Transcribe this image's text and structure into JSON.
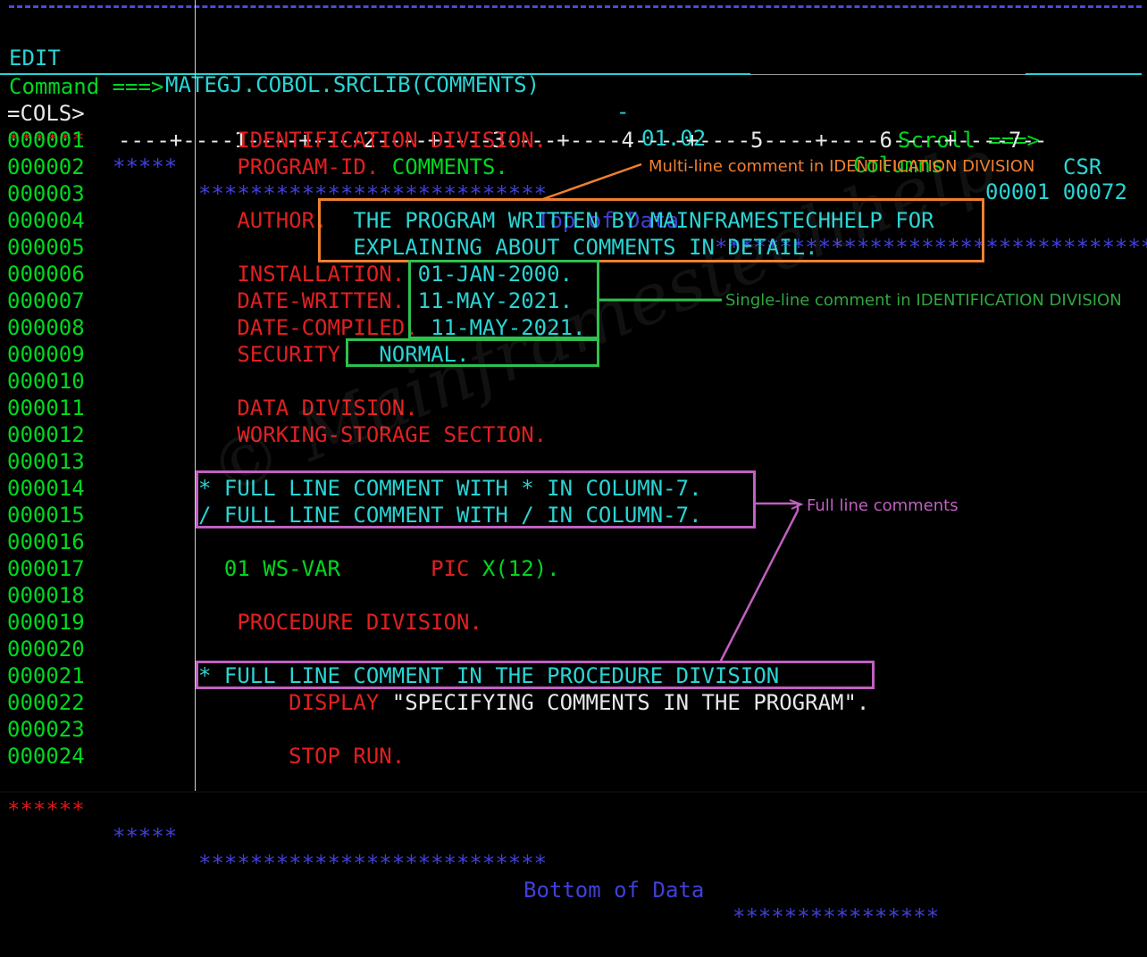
{
  "header": {
    "mode": "EDIT",
    "dataset": "MATEGJ.COBOL.SRCLIB(COMMENTS)",
    "dash": "-",
    "version": "01.02",
    "columns_label": "Columns",
    "columns_value": "00001 00072",
    "command_label": "Command ===>",
    "command_value": "",
    "scroll_label": "Scroll ===>",
    "scroll_value": "CSR"
  },
  "cols_ruler": {
    "prefix": "=COLS>",
    "ruler": "----+----1----+----2----+----3----+----4----+----5----+----6----+----7--"
  },
  "top_of_data": {
    "gutter_stars": "******",
    "stars_left": "*****",
    "stars_mid": "***************************",
    "text": "Top of Data",
    "stars_right": "*************************************"
  },
  "bottom_of_data": {
    "gutter_stars": "******",
    "stars_left": "*****",
    "stars_mid": "***************************",
    "text": "Bottom of Data",
    "stars_right": "****************"
  },
  "lines": [
    {
      "num": "000001",
      "segments": [
        {
          "t": "   IDENTIFICATION DIVISION.",
          "c": "red"
        }
      ]
    },
    {
      "num": "000002",
      "segments": [
        {
          "t": "   PROGRAM-ID. ",
          "c": "red"
        },
        {
          "t": "COMMENTS.",
          "c": "green"
        }
      ]
    },
    {
      "num": "000003",
      "segments": [
        {
          "t": "",
          "c": "red"
        }
      ]
    },
    {
      "num": "000004",
      "segments": [
        {
          "t": "   AUTHOR.  ",
          "c": "red"
        },
        {
          "t": "THE PROGRAM WRITTEN BY MAINFRAMESTECHHELP FOR",
          "c": "cyan"
        }
      ]
    },
    {
      "num": "000005",
      "segments": [
        {
          "t": "            ",
          "c": "red"
        },
        {
          "t": "EXPLAINING ABOUT COMMENTS IN DETAIL.",
          "c": "cyan"
        }
      ]
    },
    {
      "num": "000006",
      "segments": [
        {
          "t": "   INSTALLATION. ",
          "c": "red"
        },
        {
          "t": "01-JAN-2000.",
          "c": "cyan"
        }
      ]
    },
    {
      "num": "000007",
      "segments": [
        {
          "t": "   DATE-WRITTEN. ",
          "c": "red"
        },
        {
          "t": "11-MAY-2021.",
          "c": "cyan"
        }
      ]
    },
    {
      "num": "000008",
      "segments": [
        {
          "t": "   DATE-COMPILED.",
          "c": "red"
        },
        {
          "t": " 11-MAY-2021.",
          "c": "cyan"
        }
      ]
    },
    {
      "num": "000009",
      "segments": [
        {
          "t": "   SECURITY.  ",
          "c": "red"
        },
        {
          "t": "NORMAL.",
          "c": "cyan"
        }
      ]
    },
    {
      "num": "000010",
      "segments": [
        {
          "t": "",
          "c": "red"
        }
      ]
    },
    {
      "num": "000011",
      "segments": [
        {
          "t": "   DATA DIVISION.",
          "c": "red"
        }
      ]
    },
    {
      "num": "000012",
      "segments": [
        {
          "t": "   WORKING-STORAGE SECTION.",
          "c": "red"
        }
      ]
    },
    {
      "num": "000013",
      "segments": [
        {
          "t": "",
          "c": "red"
        }
      ]
    },
    {
      "num": "000014",
      "segments": [
        {
          "t": "* FULL LINE COMMENT WITH * IN COLUMN-7.",
          "c": "cyan"
        }
      ]
    },
    {
      "num": "000015",
      "segments": [
        {
          "t": "/ FULL LINE COMMENT WITH / IN COLUMN-7.",
          "c": "cyan"
        }
      ]
    },
    {
      "num": "000016",
      "segments": [
        {
          "t": "",
          "c": "red"
        }
      ]
    },
    {
      "num": "000017",
      "segments": [
        {
          "t": "  01 WS-VAR       ",
          "c": "green"
        },
        {
          "t": "PIC ",
          "c": "red"
        },
        {
          "t": "X(12).",
          "c": "green"
        }
      ]
    },
    {
      "num": "000018",
      "segments": [
        {
          "t": "",
          "c": "red"
        }
      ]
    },
    {
      "num": "000019",
      "segments": [
        {
          "t": "   PROCEDURE DIVISION.",
          "c": "red"
        }
      ]
    },
    {
      "num": "000020",
      "segments": [
        {
          "t": "",
          "c": "red"
        }
      ]
    },
    {
      "num": "000021",
      "segments": [
        {
          "t": "* FULL LINE COMMENT IN THE PROCEDURE DIVISION",
          "c": "cyan"
        }
      ]
    },
    {
      "num": "000022",
      "segments": [
        {
          "t": "       DISPLAY ",
          "c": "red"
        },
        {
          "t": "\"SPECIFYING COMMENTS IN THE PROGRAM\".",
          "c": "white"
        }
      ]
    },
    {
      "num": "000023",
      "segments": [
        {
          "t": "",
          "c": "red"
        }
      ]
    },
    {
      "num": "000024",
      "segments": [
        {
          "t": "       STOP RUN.",
          "c": "red"
        }
      ]
    }
  ],
  "annotations": [
    {
      "id": "multiline",
      "text": "Multi-line comment in IDENTIFICATION DIVISION",
      "color": "#f08030"
    },
    {
      "id": "singleline",
      "text": "Single-line comment in IDENTIFICATION DIVISION",
      "color": "#2fa840"
    },
    {
      "id": "fulllines",
      "text": "Full line comments",
      "color": "#c060c0"
    }
  ],
  "watermark": {
    "text": "© Mainframestechhelp"
  },
  "colors": {
    "background": "#000000",
    "line_number": "#00d820",
    "keyword": "#e02020",
    "comment": "#2ad4d4",
    "literal": "#e8e8e8",
    "stars": "#4040d8",
    "gutter_stars": "#d81818",
    "accent_orange": "#f08030",
    "accent_green": "#2fc04f",
    "accent_magenta": "#c060c0"
  }
}
